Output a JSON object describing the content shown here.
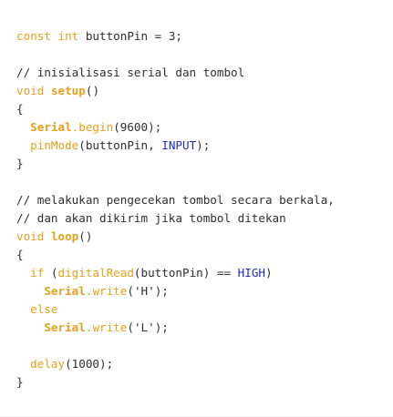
{
  "code": {
    "line1": {
      "kw1": "const",
      "kw2": "int",
      "rest": " buttonPin = 3;"
    },
    "comment1": "// inisialisasi serial dan tombol",
    "setup_sig": {
      "kw": "void",
      "fn": "setup",
      "tail": "()"
    },
    "brace_open1": "{",
    "serial_begin": {
      "obj": "Serial",
      "dot": ".",
      "fn": "begin",
      "args": "(9600);"
    },
    "pinmode": {
      "fn": "pinMode",
      "args_start": "(buttonPin, ",
      "const": "INPUT",
      "args_end": ");"
    },
    "brace_close1": "}",
    "comment2": "// melakukan pengecekan tombol secara berkala,",
    "comment3": "// dan akan dikirim jika tombol ditekan",
    "loop_sig": {
      "kw": "void",
      "fn": "loop",
      "tail": "()"
    },
    "brace_open2": "{",
    "if_line": {
      "kw": "if",
      "open": " (",
      "fn": "digitalRead",
      "args": "(buttonPin) == ",
      "const": "HIGH",
      "close": ")"
    },
    "write_h": {
      "obj": "Serial",
      "dot": ".",
      "fn": "write",
      "args": "('H');"
    },
    "else_kw": "else",
    "write_l": {
      "obj": "Serial",
      "dot": ".",
      "fn": "write",
      "args": "('L');"
    },
    "delay": {
      "fn": "delay",
      "args": "(1000);"
    },
    "brace_close2": "}"
  },
  "colors": {
    "keyword": "#e5a11b",
    "constant": "#1f2bd1",
    "text": "#2f2f2f",
    "background": "#ffffff"
  }
}
